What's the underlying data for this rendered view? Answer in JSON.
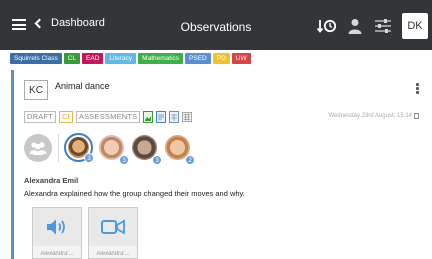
{
  "header": {
    "back_label": "Dashboard",
    "title": "Observations",
    "user_initials": "DK",
    "icons": [
      "menu-icon",
      "sort-time-icon",
      "person-icon",
      "filter-sliders-icon"
    ]
  },
  "tags": [
    {
      "label": "Squirrels Class",
      "color": "#3a6ea5"
    },
    {
      "label": "CL",
      "color": "#3a9a3a"
    },
    {
      "label": "EAD",
      "color": "#c2185b"
    },
    {
      "label": "Literacy",
      "color": "#62b7e6"
    },
    {
      "label": "Mathematics",
      "color": "#3fae49"
    },
    {
      "label": "PSED",
      "color": "#5c8fd0"
    },
    {
      "label": "PD",
      "color": "#f2c12e"
    },
    {
      "label": "UW",
      "color": "#d64545"
    }
  ],
  "observation": {
    "author_initials": "KC",
    "title": "Animal dance",
    "status_pills": [
      "DRAFT",
      "CI",
      "ASSESSMENTS"
    ],
    "date": "Wednesday 23rd August, 15:14",
    "children": [
      {
        "name": "child-1",
        "badge": "3",
        "selected": true,
        "face": "#c98f5a"
      },
      {
        "name": "child-2",
        "badge": "3",
        "selected": false,
        "face": "#e8b9a0"
      },
      {
        "name": "child-3",
        "badge": "3",
        "selected": false,
        "face": "#9c8070"
      },
      {
        "name": "child-4",
        "badge": "2",
        "selected": false,
        "face": "#d9a878"
      }
    ],
    "child_name": "Alexandra Emil",
    "text": "Alexandra explained how the group changed their moves and why.",
    "media": [
      {
        "type": "audio",
        "icon": "speaker-icon",
        "caption": "Alexandra'..."
      },
      {
        "type": "video",
        "icon": "video-camera-icon",
        "caption": "Alexandra'..."
      }
    ]
  },
  "colors": {
    "header_bg": "#333639",
    "accent": "#5b8ec9",
    "media_icon": "#4a9be0"
  }
}
